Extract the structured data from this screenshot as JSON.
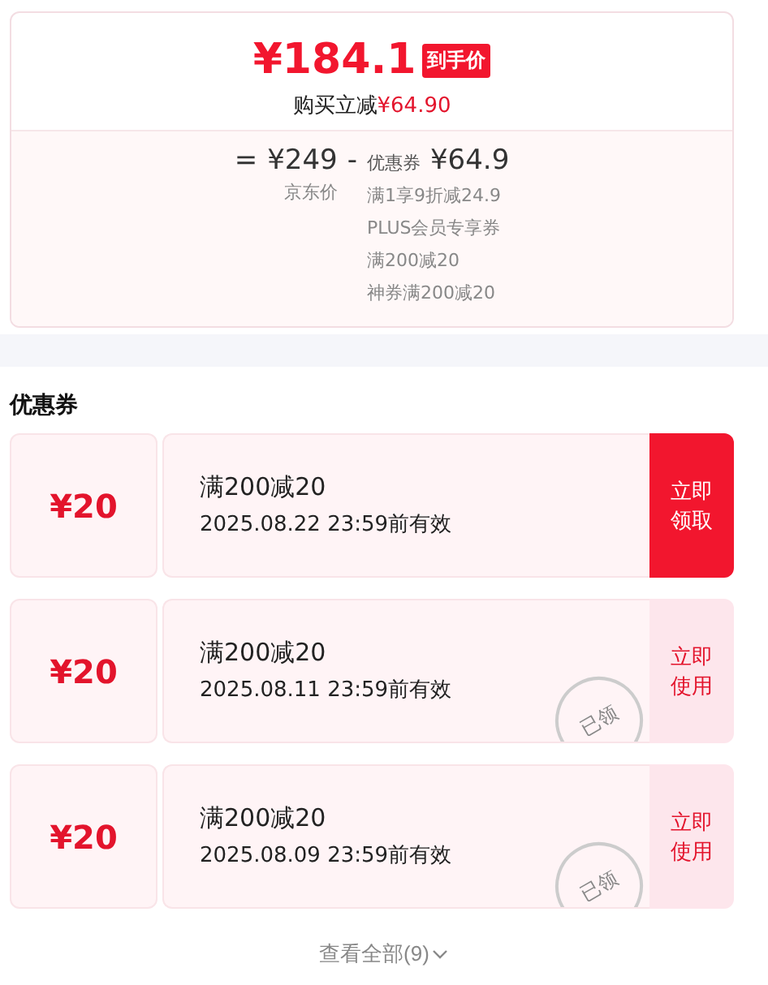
{
  "price_card": {
    "final_price": "¥184.1",
    "price_tag": "到手价",
    "saving_label": "购买立减",
    "saving_amount": "¥64.90",
    "equals": "=",
    "original_price": "¥249",
    "original_label": "京东价",
    "minus": "-",
    "discount_label": "优惠券",
    "discount_amount": "¥64.9",
    "discount_details": [
      "满1享9折减24.9",
      "PLUS会员专享券",
      "满200减20",
      "神券满200减20"
    ]
  },
  "coupons_section": {
    "title": "优惠券",
    "coupons": [
      {
        "amount": "¥20",
        "condition": "满200减20",
        "validity": "2025.08.22 23:59前有效",
        "action": "立即领取",
        "claimed": false
      },
      {
        "amount": "¥20",
        "condition": "满200减20",
        "validity": "2025.08.11 23:59前有效",
        "action": "立即使用",
        "claimed": true,
        "stamp": "已领"
      },
      {
        "amount": "¥20",
        "condition": "满200减20",
        "validity": "2025.08.09 23:59前有效",
        "action": "立即使用",
        "claimed": true,
        "stamp": "已领"
      }
    ],
    "view_all": "查看全部(9)"
  }
}
